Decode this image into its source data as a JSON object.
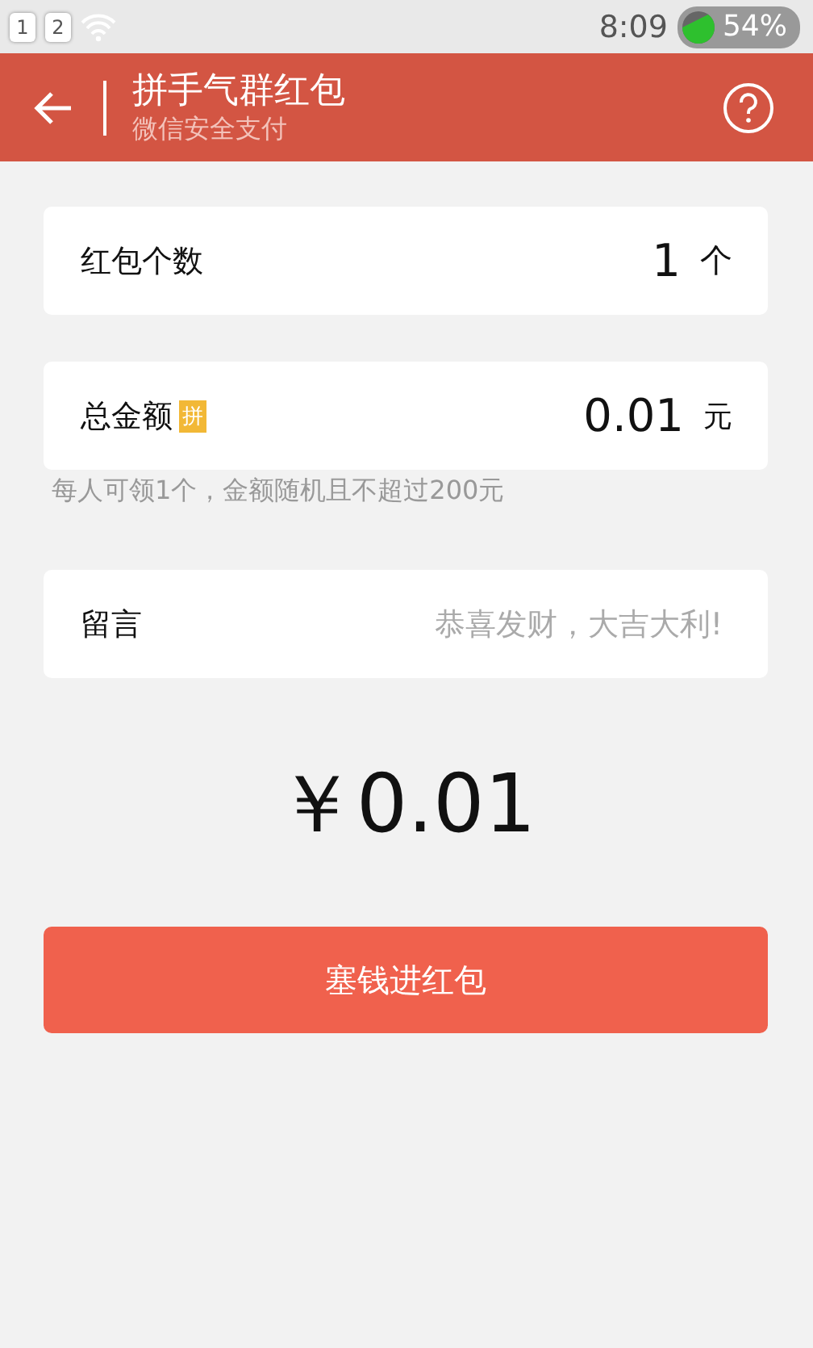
{
  "status_bar": {
    "sim_slots": [
      "1",
      "2"
    ],
    "time": "8:09",
    "battery": "54%"
  },
  "header": {
    "title": "拼手气群红包",
    "subtitle": "微信安全支付"
  },
  "count": {
    "label": "红包个数",
    "value": "1",
    "unit": "个"
  },
  "amount": {
    "label": "总金额",
    "badge": "拼",
    "value": "0.01",
    "unit": "元"
  },
  "hint": "每人可领1个，金额随机且不超过200元",
  "message": {
    "label": "留言",
    "placeholder": "恭喜发财，大吉大利!"
  },
  "total": "￥0.01",
  "submit": "塞钱进红包"
}
